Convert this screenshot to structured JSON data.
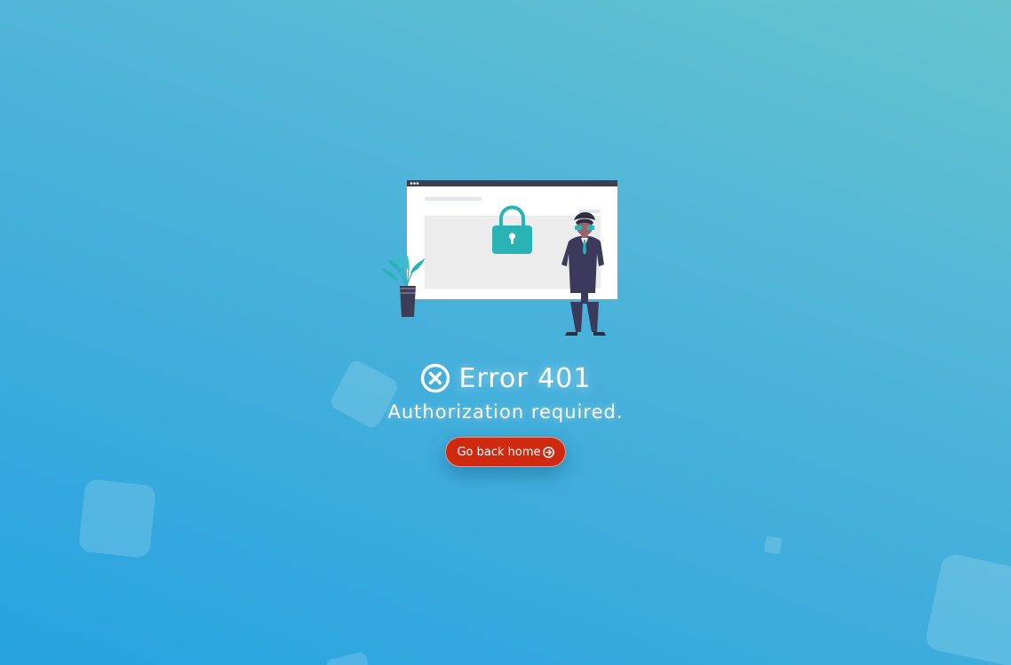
{
  "error": {
    "title": "Error 401",
    "message": "Authorization required."
  },
  "button": {
    "label": "Go back home"
  },
  "icons": {
    "error": "circle-x-icon",
    "button": "circle-arrow-right-icon",
    "illustration": "locked-browser-illustration"
  },
  "colors": {
    "button_bg": "#cf2a10",
    "lock": "#2ab3b4",
    "figure": "#3b3a5c"
  }
}
